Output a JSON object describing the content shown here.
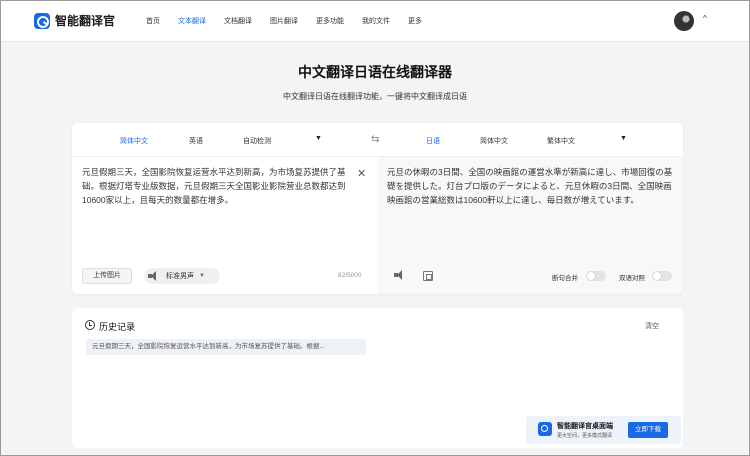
{
  "app": {
    "name": "智能翻译官"
  },
  "nav": {
    "items": [
      "首页",
      "文本翻译",
      "文档翻译",
      "图片翻译",
      "更多功能",
      "我的文件",
      "更多"
    ],
    "active_index": 1
  },
  "user": {
    "menu_caret": "^"
  },
  "hero": {
    "title": "中文翻译日语在线翻译器",
    "subtitle": "中文翻译日语在线翻译功能，一键将中文翻译成日语"
  },
  "translator": {
    "source_langs": [
      "简体中文",
      "英语",
      "自动检测"
    ],
    "target_langs": [
      "日语",
      "简体中文",
      "繁体中文"
    ],
    "dropdown_caret": "▼",
    "swap_glyph": "⇆",
    "source_text": "元旦假期三天，全国影院恢复运营水平达到新高，为市场复苏提供了基础。根据灯塔专业版数据，元旦假期三天全国影业影院营业总数都达到10600家以上，且每天的数量都在增多。",
    "clear_glyph": "✕",
    "target_text": "元旦の休暇の3日間、全国の映画館の運営水準が新高に達し、市場回復の基礎を提供した。灯台プロ版のデータによると、元旦休暇の3日間、全国映画映画館の営業総数は10600軒以上に達し、毎日数が増えています。",
    "upload_label": "上传图片",
    "voice_label": "标准男声",
    "char_count": "82/5000",
    "toggle_sentence_merge": "断句合并",
    "toggle_bilingual": "双语对照"
  },
  "history": {
    "title": "历史记录",
    "clear_label": "清空",
    "items": [
      "元旦假期三天，全国影院恢复运营水平达到新高，为市场复苏提供了基础。根据..."
    ]
  },
  "desktop_promo": {
    "title": "智能翻译官桌面端",
    "subtitle": "更大空间，更多模式翻译",
    "button": "立即下载"
  },
  "colors": {
    "accent": "#1769e6",
    "background": "#f3f4f6"
  }
}
